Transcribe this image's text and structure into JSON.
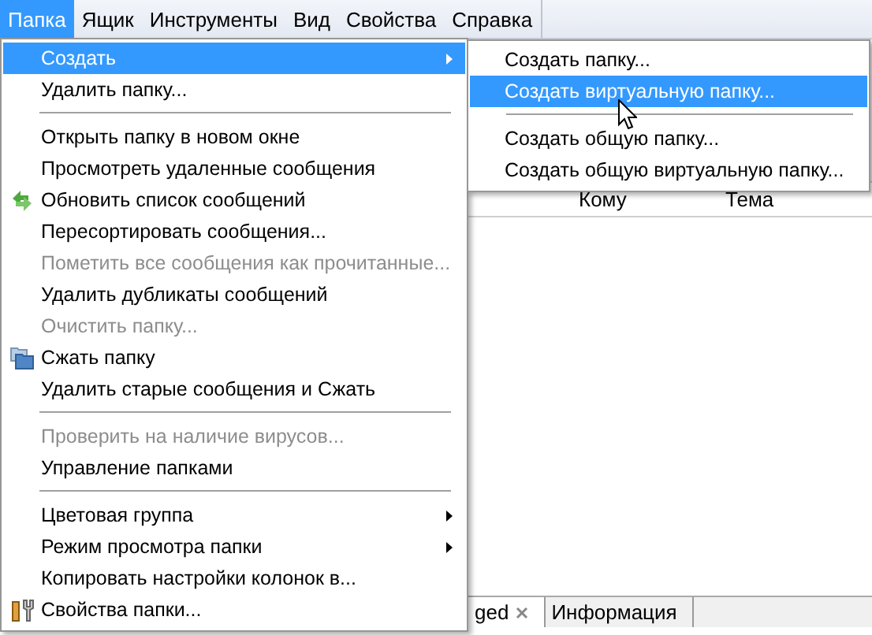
{
  "menubar": [
    {
      "label": "Папка",
      "selected": true
    },
    {
      "label": "Ящик",
      "selected": false
    },
    {
      "label": "Инструменты",
      "selected": false
    },
    {
      "label": "Вид",
      "selected": false
    },
    {
      "label": "Свойства",
      "selected": false
    },
    {
      "label": "Справка",
      "selected": false
    }
  ],
  "column_headers": [
    "Кому",
    "Тема"
  ],
  "bottom_tabs": [
    {
      "label": "ged",
      "closable": true,
      "selected": true
    },
    {
      "label": "Информация",
      "closable": false,
      "selected": false
    }
  ],
  "menu": [
    {
      "kind": "item",
      "label": "Создать",
      "selected": true,
      "disabled": false,
      "submenu": true
    },
    {
      "kind": "item",
      "label": "Удалить папку...",
      "selected": false,
      "disabled": false,
      "submenu": false
    },
    {
      "kind": "separator"
    },
    {
      "kind": "item",
      "label": "Открыть папку в новом окне",
      "selected": false,
      "disabled": false,
      "submenu": false
    },
    {
      "kind": "item",
      "label": "Просмотреть удаленные сообщения",
      "selected": false,
      "disabled": false,
      "submenu": false
    },
    {
      "kind": "item",
      "label": "Обновить список сообщений",
      "selected": false,
      "disabled": false,
      "submenu": false
    },
    {
      "kind": "item",
      "label": "Пересортировать сообщения...",
      "selected": false,
      "disabled": false,
      "submenu": false
    },
    {
      "kind": "item",
      "label": "Пометить все сообщения как прочитанные...",
      "selected": false,
      "disabled": true,
      "submenu": false
    },
    {
      "kind": "item",
      "label": "Удалить дубликаты сообщений",
      "selected": false,
      "disabled": false,
      "submenu": false
    },
    {
      "kind": "item",
      "label": "Очистить папку...",
      "selected": false,
      "disabled": true,
      "submenu": false
    },
    {
      "kind": "item",
      "label": "Сжать папку",
      "selected": false,
      "disabled": false,
      "submenu": false
    },
    {
      "kind": "item",
      "label": "Удалить старые сообщения и Сжать",
      "selected": false,
      "disabled": false,
      "submenu": false
    },
    {
      "kind": "separator"
    },
    {
      "kind": "item",
      "label": "Проверить на наличие вирусов...",
      "selected": false,
      "disabled": true,
      "submenu": false
    },
    {
      "kind": "item",
      "label": "Управление папками",
      "selected": false,
      "disabled": false,
      "submenu": false
    },
    {
      "kind": "separator"
    },
    {
      "kind": "item",
      "label": "Цветовая группа",
      "selected": false,
      "disabled": false,
      "submenu": true
    },
    {
      "kind": "item",
      "label": "Режим просмотра папки",
      "selected": false,
      "disabled": false,
      "submenu": true
    },
    {
      "kind": "item",
      "label": "Копировать настройки колонок в...",
      "selected": false,
      "disabled": false,
      "submenu": false
    },
    {
      "kind": "item",
      "label": "Свойства папки...",
      "selected": false,
      "disabled": false,
      "submenu": false
    }
  ],
  "submenu": [
    {
      "kind": "item",
      "label": "Создать папку...",
      "selected": false,
      "disabled": false
    },
    {
      "kind": "item",
      "label": "Создать виртуальную папку...",
      "selected": true,
      "disabled": false
    },
    {
      "kind": "separator"
    },
    {
      "kind": "item",
      "label": "Создать общую папку...",
      "selected": false,
      "disabled": false
    },
    {
      "kind": "item",
      "label": "Создать общую виртуальную папку...",
      "selected": false,
      "disabled": false
    }
  ]
}
